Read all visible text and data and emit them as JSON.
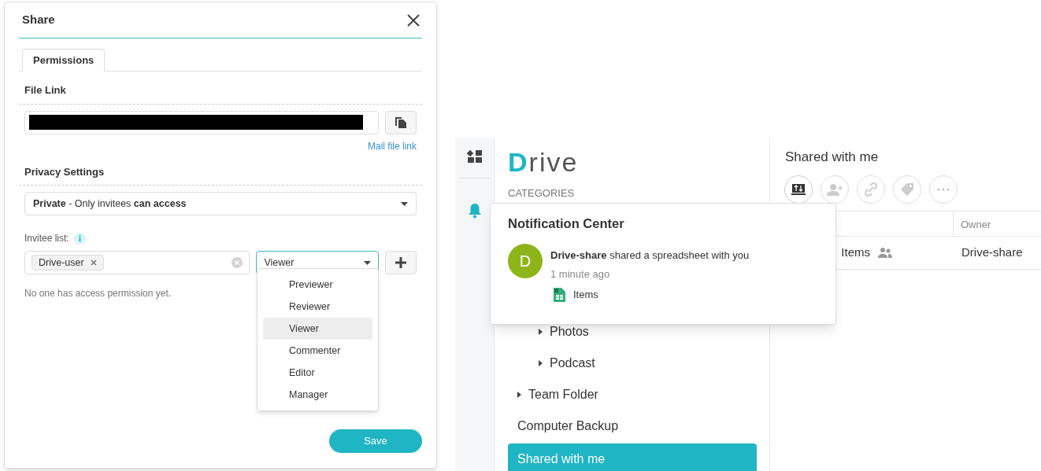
{
  "share_dialog": {
    "title": "Share",
    "tabs": [
      {
        "label": "Permissions",
        "selected": true
      }
    ],
    "file_link": {
      "heading": "File Link",
      "mail_link": "Mail file link"
    },
    "privacy": {
      "heading": "Privacy Settings",
      "value": "**Private** - Only invitees **can access**"
    },
    "invitees": {
      "label": "Invitee list:",
      "tokens": [
        "Drive-user"
      ],
      "role": "Viewer",
      "empty_note": "No one has access permission yet."
    },
    "role_menu": [
      {
        "label": "Previewer",
        "selected": false
      },
      {
        "label": "Reviewer",
        "selected": false
      },
      {
        "label": "Viewer",
        "selected": true
      },
      {
        "label": "Commenter",
        "selected": false
      },
      {
        "label": "Editor",
        "selected": false
      },
      {
        "label": "Manager",
        "selected": false
      }
    ],
    "save_button": "Save"
  },
  "drive": {
    "logo": "Drive",
    "categories_heading": "CATEGORIES",
    "sidebar": [
      {
        "label": "Photos",
        "indented": true,
        "arrow": true,
        "selected": false
      },
      {
        "label": "Podcast",
        "indented": true,
        "arrow": true,
        "selected": false
      },
      {
        "label": "Team Folder",
        "indented": false,
        "arrow": true,
        "selected": false
      },
      {
        "label": "Computer Backup",
        "indented": false,
        "arrow": false,
        "selected": false
      },
      {
        "label": "Shared with me",
        "indented": false,
        "arrow": false,
        "selected": true
      }
    ],
    "page_title": "Shared with me",
    "table": {
      "columns": [
        "Owner"
      ],
      "rows": [
        {
          "name": "Items",
          "owner": "Drive-share"
        }
      ]
    },
    "notification_center": {
      "title": "Notification Center",
      "items": [
        {
          "avatar": "D",
          "color": "#8db51a",
          "message": "**Drive-share** shared a spreadsheet with you",
          "time": "1 minute ago",
          "file": "Items"
        }
      ]
    }
  }
}
